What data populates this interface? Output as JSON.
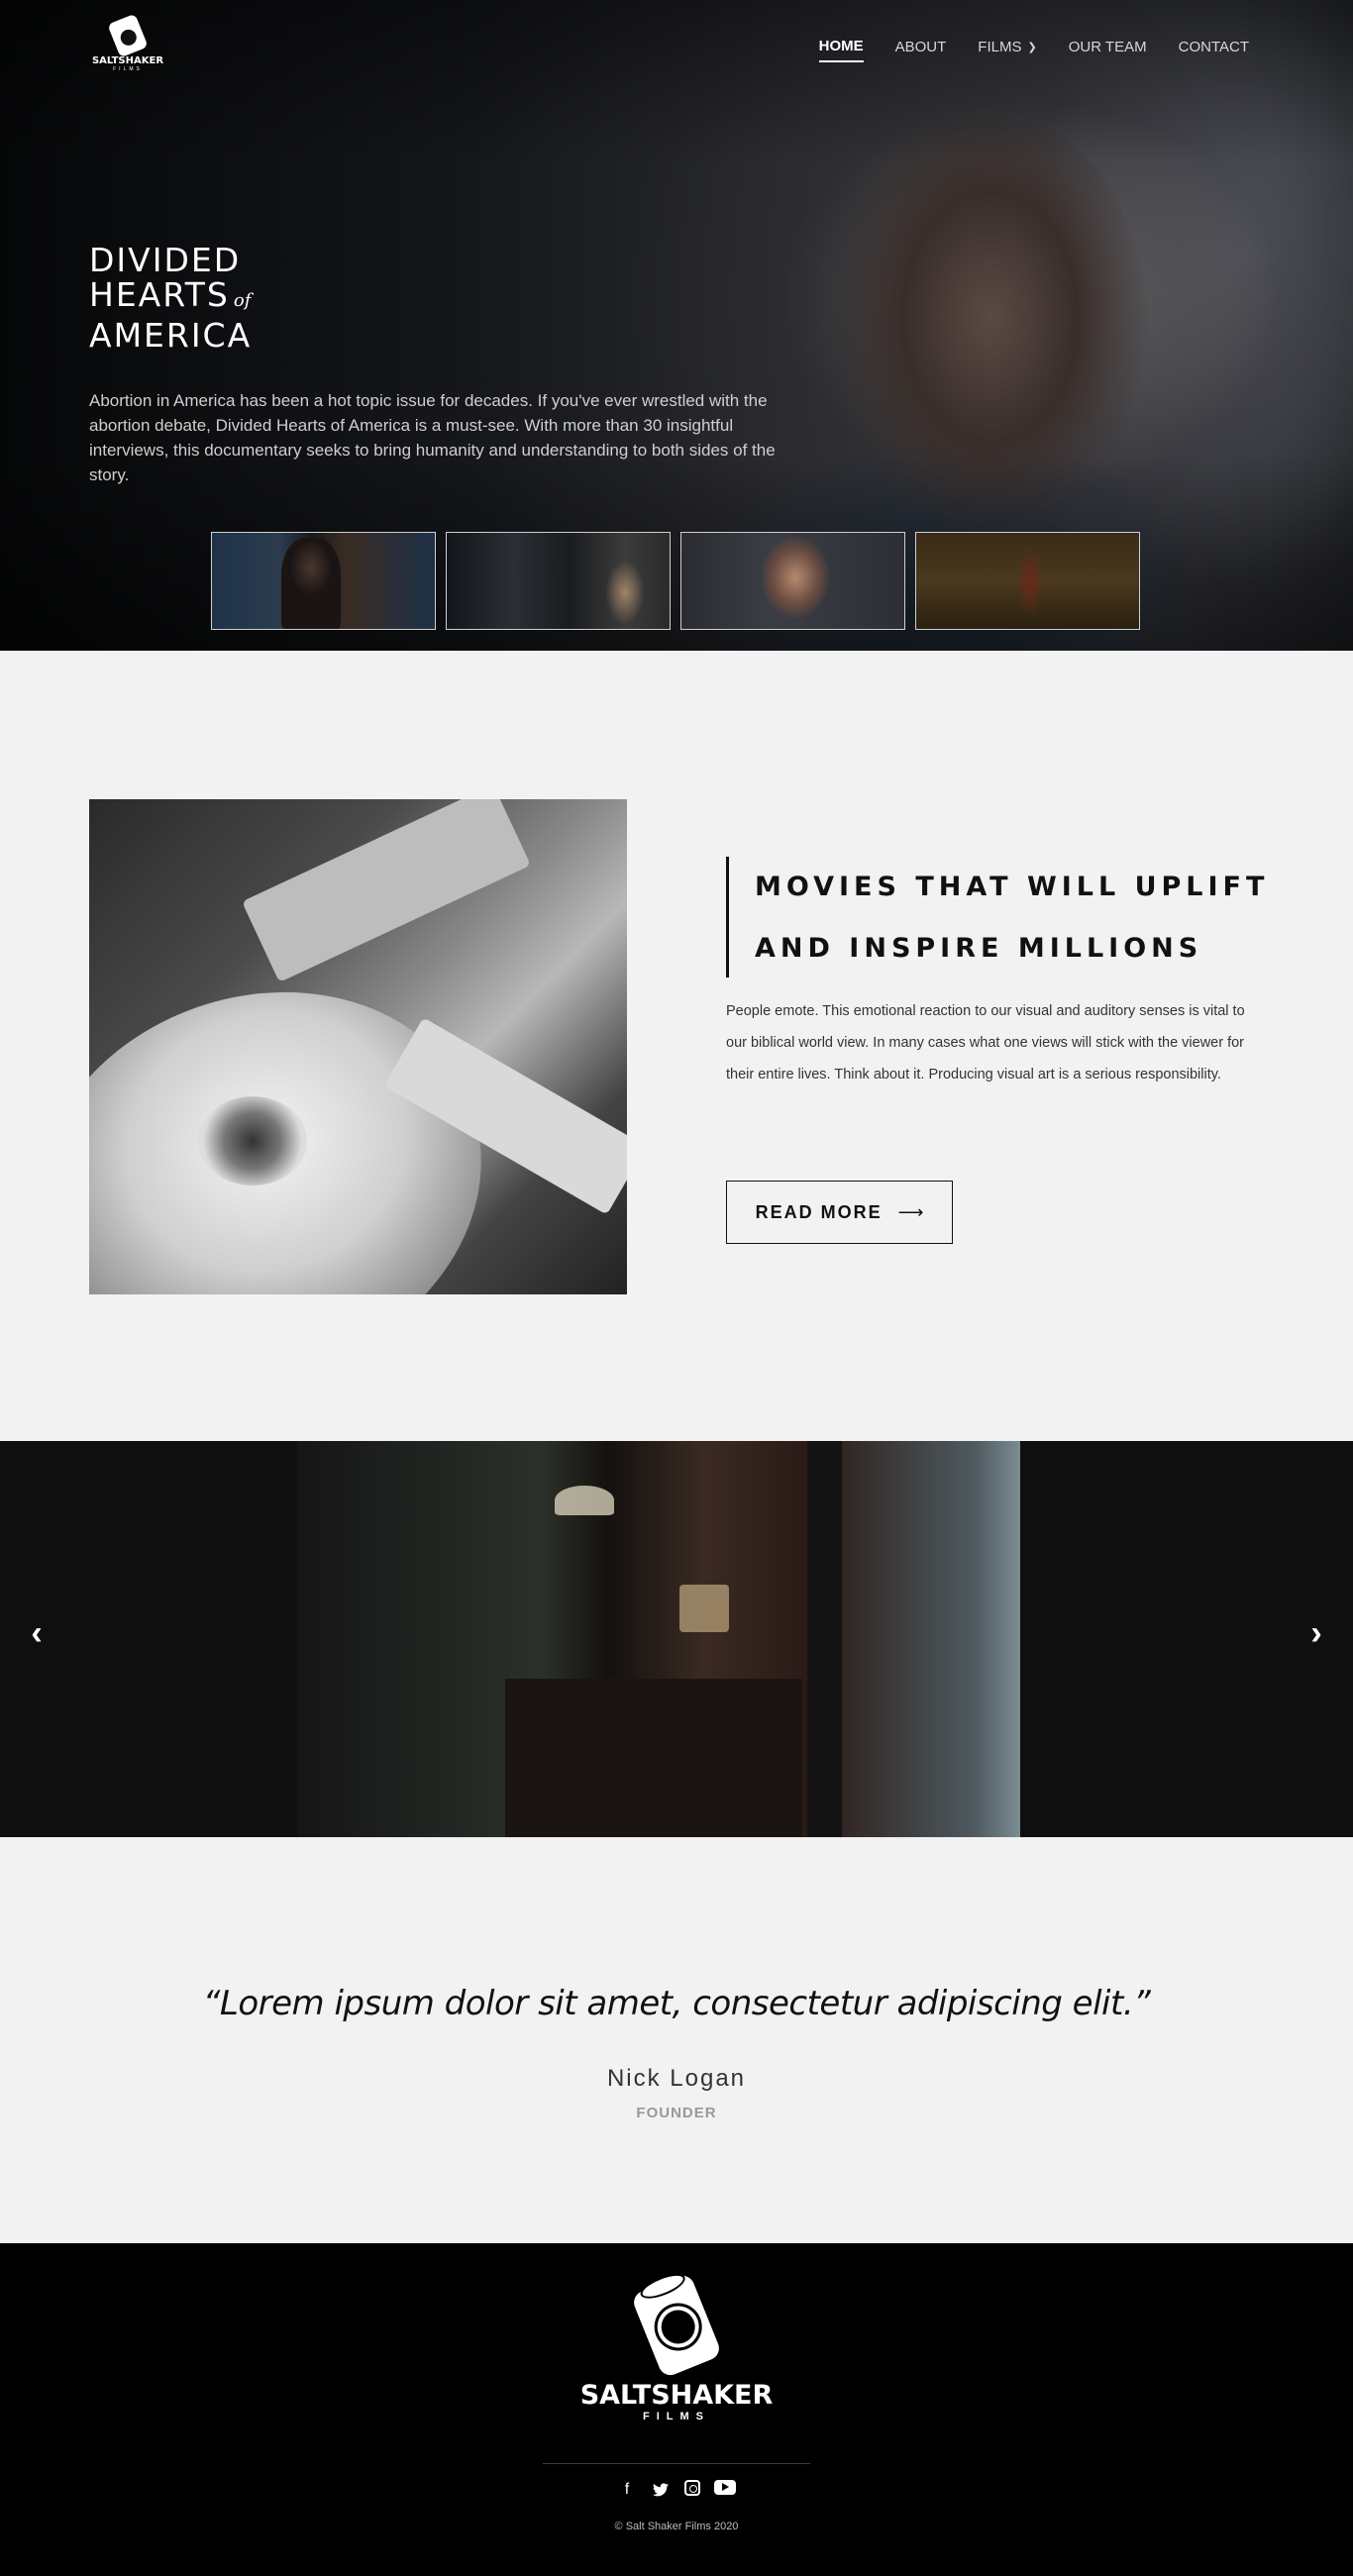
{
  "brand": {
    "name": "SALTSHAKER",
    "sub": "FILMS"
  },
  "nav": [
    {
      "label": "HOME",
      "active": true
    },
    {
      "label": "ABOUT"
    },
    {
      "label": "FILMS"
    },
    {
      "label": "OUR TEAM"
    },
    {
      "label": "CONTACT"
    }
  ],
  "hero": {
    "title_line1": "DIVIDED",
    "title_line2": "HEARTS",
    "title_of": "of",
    "title_line3": "AMERICA",
    "description": "Abortion in America has been a hot topic issue for decades. If you've ever wrestled with the abortion debate, Divided Hearts of America is a must-see. With more than 30 insightful interviews, this documentary seeks to bring humanity and understanding to both sides of the story."
  },
  "feature": {
    "heading_line1": "MOVIES THAT WILL UPLIFT",
    "heading_line2": "AND INSPIRE MILLIONS",
    "text": "People emote. This emotional reaction to our visual and auditory senses is vital to our biblical world view. In many cases what one views will stick with the viewer for their entire lives. Think about it. Producing visual art is a serious responsibility.",
    "button_label": "READ MORE",
    "button_arrow": "⟶"
  },
  "slider": {
    "prev": "‹",
    "next": "›",
    "slide_count": 4,
    "active_index": 0
  },
  "testimonial": {
    "quote": "“Lorem ipsum dolor sit amet, consectetur adipiscing elit.”",
    "name": "Nick Logan",
    "role": "FOUNDER"
  },
  "footer": {
    "socials": [
      "facebook-icon",
      "twitter-icon",
      "instagram-icon",
      "youtube-icon"
    ],
    "facebook_glyph": "f",
    "twitter_glyph": "🐦",
    "copyright": "© Salt Shaker Films 2020"
  }
}
